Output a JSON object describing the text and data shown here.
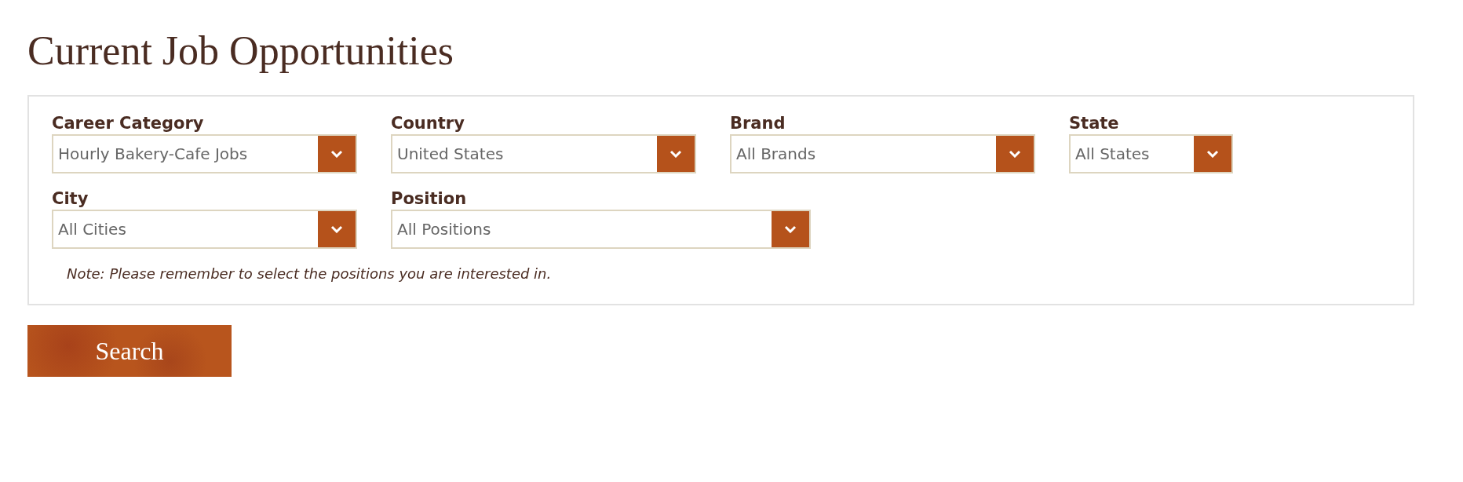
{
  "title": "Current Job Opportunities",
  "filter_rows": [
    {
      "fields": [
        {
          "label": "Career Category",
          "value": "Hourly Bakery-Cafe Jobs"
        },
        {
          "label": "Country",
          "value": "United States"
        },
        {
          "label": "Brand",
          "value": "All Brands"
        },
        {
          "label": "State",
          "value": "All States"
        }
      ]
    },
    {
      "fields": [
        {
          "label": "City",
          "value": "All Cities"
        },
        {
          "label": "Position",
          "value": "All Positions"
        }
      ]
    }
  ],
  "note": "Note: Please remember to select the positions you are interested in.",
  "search_button": "Search"
}
